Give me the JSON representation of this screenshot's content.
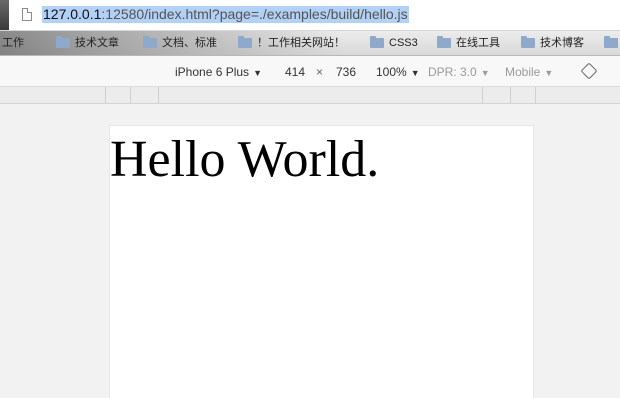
{
  "address_bar": {
    "url_host": "127.0.0.1",
    "url_rest": ":12580/index.html?page=./examples/build/hello.js"
  },
  "bookmarks": [
    {
      "label": "工作"
    },
    {
      "label": "技术文章"
    },
    {
      "label": "文档、标准"
    },
    {
      "label": "！工作相关网站！"
    },
    {
      "label": "CSS3"
    },
    {
      "label": "在线工具"
    },
    {
      "label": "技术博客"
    }
  ],
  "device_toolbar": {
    "device": "iPhone 6 Plus",
    "width": "414",
    "times": "×",
    "height": "736",
    "zoom": "100%",
    "dpr": "DPR: 3.0",
    "mode": "Mobile",
    "caret": "▼",
    "rotate_icon": "rotate-icon"
  },
  "page": {
    "heading": "Hello World."
  }
}
